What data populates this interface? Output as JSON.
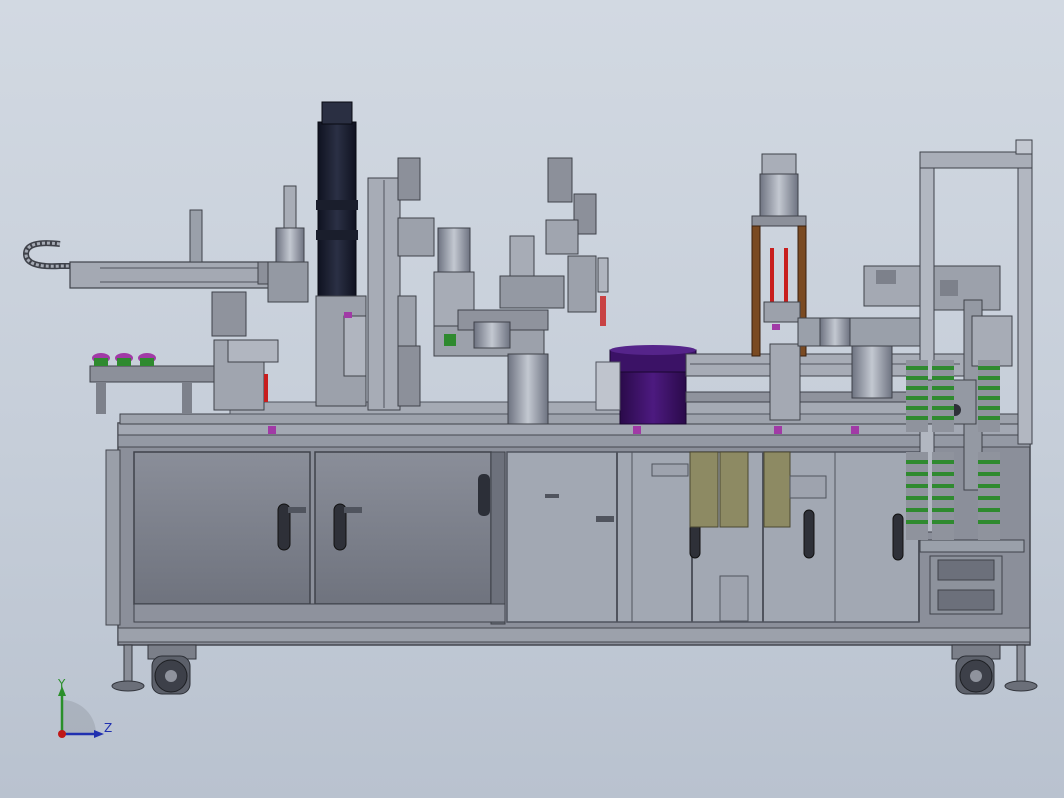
{
  "viewport": {
    "background_top": "#d2d9e2",
    "background_bottom": "#b9c2cf"
  },
  "colors": {
    "frame": "#8d919c",
    "frame_dark": "#50545e",
    "panel": "#7f838f",
    "panel_light": "#a6abb6",
    "glass": "#b5bcc7",
    "purple": "#3b1266",
    "dark_cylinder": "#1d2132",
    "olive": "#8b8660",
    "green": "#2f8a2f",
    "magenta": "#a13aa6",
    "brown": "#7a4a22",
    "red": "#c81e1e"
  },
  "triad": {
    "y_label": "Y",
    "z_label": "Z",
    "y_color": "#2a8f2a",
    "z_color": "#2030b0",
    "origin_color": "#c01818"
  }
}
